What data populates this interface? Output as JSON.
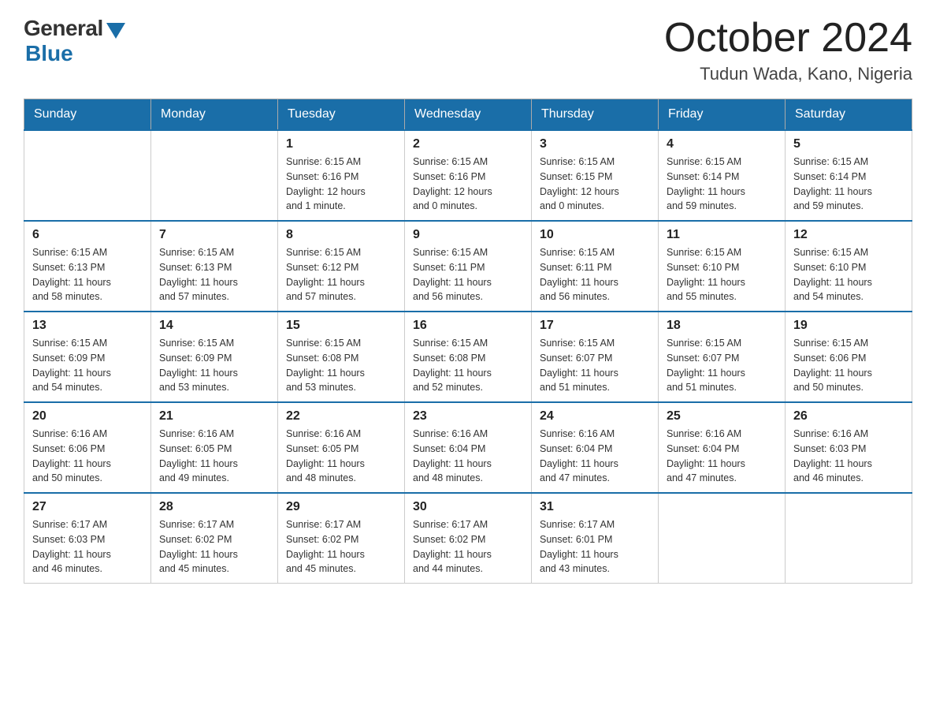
{
  "header": {
    "logo_general": "General",
    "logo_blue": "Blue",
    "month_title": "October 2024",
    "location": "Tudun Wada, Kano, Nigeria"
  },
  "days_of_week": [
    "Sunday",
    "Monday",
    "Tuesday",
    "Wednesday",
    "Thursday",
    "Friday",
    "Saturday"
  ],
  "weeks": [
    {
      "days": [
        {
          "number": "",
          "info": ""
        },
        {
          "number": "",
          "info": ""
        },
        {
          "number": "1",
          "info": "Sunrise: 6:15 AM\nSunset: 6:16 PM\nDaylight: 12 hours\nand 1 minute."
        },
        {
          "number": "2",
          "info": "Sunrise: 6:15 AM\nSunset: 6:16 PM\nDaylight: 12 hours\nand 0 minutes."
        },
        {
          "number": "3",
          "info": "Sunrise: 6:15 AM\nSunset: 6:15 PM\nDaylight: 12 hours\nand 0 minutes."
        },
        {
          "number": "4",
          "info": "Sunrise: 6:15 AM\nSunset: 6:14 PM\nDaylight: 11 hours\nand 59 minutes."
        },
        {
          "number": "5",
          "info": "Sunrise: 6:15 AM\nSunset: 6:14 PM\nDaylight: 11 hours\nand 59 minutes."
        }
      ]
    },
    {
      "days": [
        {
          "number": "6",
          "info": "Sunrise: 6:15 AM\nSunset: 6:13 PM\nDaylight: 11 hours\nand 58 minutes."
        },
        {
          "number": "7",
          "info": "Sunrise: 6:15 AM\nSunset: 6:13 PM\nDaylight: 11 hours\nand 57 minutes."
        },
        {
          "number": "8",
          "info": "Sunrise: 6:15 AM\nSunset: 6:12 PM\nDaylight: 11 hours\nand 57 minutes."
        },
        {
          "number": "9",
          "info": "Sunrise: 6:15 AM\nSunset: 6:11 PM\nDaylight: 11 hours\nand 56 minutes."
        },
        {
          "number": "10",
          "info": "Sunrise: 6:15 AM\nSunset: 6:11 PM\nDaylight: 11 hours\nand 56 minutes."
        },
        {
          "number": "11",
          "info": "Sunrise: 6:15 AM\nSunset: 6:10 PM\nDaylight: 11 hours\nand 55 minutes."
        },
        {
          "number": "12",
          "info": "Sunrise: 6:15 AM\nSunset: 6:10 PM\nDaylight: 11 hours\nand 54 minutes."
        }
      ]
    },
    {
      "days": [
        {
          "number": "13",
          "info": "Sunrise: 6:15 AM\nSunset: 6:09 PM\nDaylight: 11 hours\nand 54 minutes."
        },
        {
          "number": "14",
          "info": "Sunrise: 6:15 AM\nSunset: 6:09 PM\nDaylight: 11 hours\nand 53 minutes."
        },
        {
          "number": "15",
          "info": "Sunrise: 6:15 AM\nSunset: 6:08 PM\nDaylight: 11 hours\nand 53 minutes."
        },
        {
          "number": "16",
          "info": "Sunrise: 6:15 AM\nSunset: 6:08 PM\nDaylight: 11 hours\nand 52 minutes."
        },
        {
          "number": "17",
          "info": "Sunrise: 6:15 AM\nSunset: 6:07 PM\nDaylight: 11 hours\nand 51 minutes."
        },
        {
          "number": "18",
          "info": "Sunrise: 6:15 AM\nSunset: 6:07 PM\nDaylight: 11 hours\nand 51 minutes."
        },
        {
          "number": "19",
          "info": "Sunrise: 6:15 AM\nSunset: 6:06 PM\nDaylight: 11 hours\nand 50 minutes."
        }
      ]
    },
    {
      "days": [
        {
          "number": "20",
          "info": "Sunrise: 6:16 AM\nSunset: 6:06 PM\nDaylight: 11 hours\nand 50 minutes."
        },
        {
          "number": "21",
          "info": "Sunrise: 6:16 AM\nSunset: 6:05 PM\nDaylight: 11 hours\nand 49 minutes."
        },
        {
          "number": "22",
          "info": "Sunrise: 6:16 AM\nSunset: 6:05 PM\nDaylight: 11 hours\nand 48 minutes."
        },
        {
          "number": "23",
          "info": "Sunrise: 6:16 AM\nSunset: 6:04 PM\nDaylight: 11 hours\nand 48 minutes."
        },
        {
          "number": "24",
          "info": "Sunrise: 6:16 AM\nSunset: 6:04 PM\nDaylight: 11 hours\nand 47 minutes."
        },
        {
          "number": "25",
          "info": "Sunrise: 6:16 AM\nSunset: 6:04 PM\nDaylight: 11 hours\nand 47 minutes."
        },
        {
          "number": "26",
          "info": "Sunrise: 6:16 AM\nSunset: 6:03 PM\nDaylight: 11 hours\nand 46 minutes."
        }
      ]
    },
    {
      "days": [
        {
          "number": "27",
          "info": "Sunrise: 6:17 AM\nSunset: 6:03 PM\nDaylight: 11 hours\nand 46 minutes."
        },
        {
          "number": "28",
          "info": "Sunrise: 6:17 AM\nSunset: 6:02 PM\nDaylight: 11 hours\nand 45 minutes."
        },
        {
          "number": "29",
          "info": "Sunrise: 6:17 AM\nSunset: 6:02 PM\nDaylight: 11 hours\nand 45 minutes."
        },
        {
          "number": "30",
          "info": "Sunrise: 6:17 AM\nSunset: 6:02 PM\nDaylight: 11 hours\nand 44 minutes."
        },
        {
          "number": "31",
          "info": "Sunrise: 6:17 AM\nSunset: 6:01 PM\nDaylight: 11 hours\nand 43 minutes."
        },
        {
          "number": "",
          "info": ""
        },
        {
          "number": "",
          "info": ""
        }
      ]
    }
  ]
}
